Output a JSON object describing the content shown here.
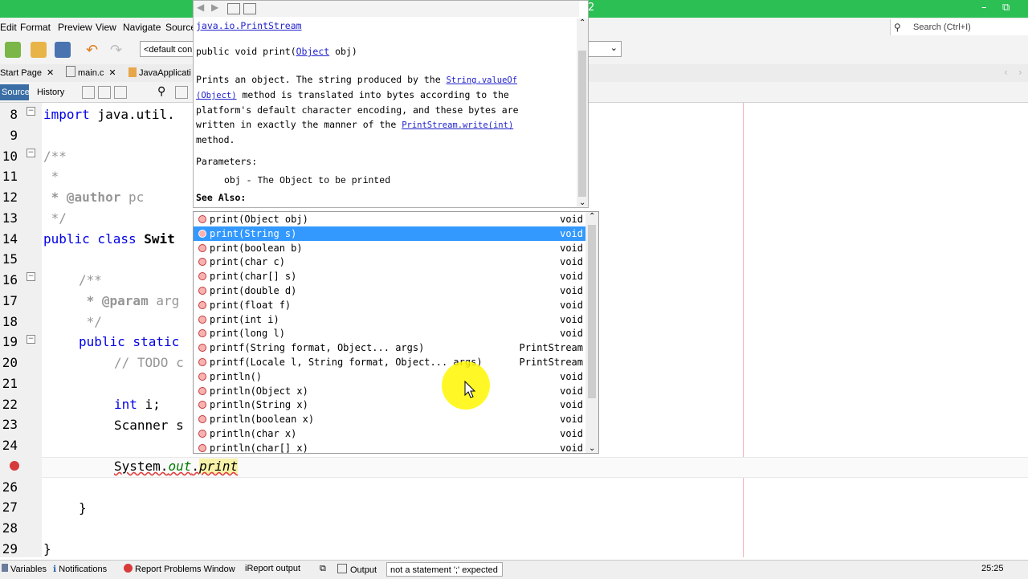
{
  "menu": {
    "items": [
      "Edit",
      "Format",
      "Preview",
      "View",
      "Navigate",
      "Source"
    ],
    "search_placeholder": "Search (Ctrl+I)"
  },
  "toolbar": {
    "config_value": "<default con"
  },
  "tabs": [
    {
      "label": "Start Page"
    },
    {
      "label": "main.c"
    },
    {
      "label": "JavaApplicati"
    }
  ],
  "editor_toolbar": {
    "source_label": "Source",
    "history_label": "History"
  },
  "editor": {
    "line_numbers": [
      "8",
      "9",
      "10",
      "11",
      "12",
      "13",
      "14",
      "15",
      "16",
      "17",
      "18",
      "19",
      "20",
      "21",
      "22",
      "23",
      "24",
      "",
      "26",
      "27",
      "28",
      "29"
    ],
    "lines": {
      "l8_kw": "import",
      "l8_rest": " java.util.",
      "l10": "/**",
      "l11": " *",
      "l12_tag": " * @author",
      "l12_rest": " pc",
      "l13": " */",
      "l14_kw": "public class",
      "l14_rest": " Swit",
      "l16": "/**",
      "l17_tag": " * @param",
      "l17_rest": " arg",
      "l18": " */",
      "l19_kw": "public static",
      "l20": "// TODO c",
      "l22_kw": "int",
      "l22_rest": " i;",
      "l23": "Scanner s",
      "l25_a": "System.",
      "l25_b": "out",
      "l25_c": ".",
      "l25_d": "print",
      "l27": "}",
      "l29": "}"
    }
  },
  "javadoc": {
    "class_link": "java.io.PrintStream",
    "signature_pre": "public void print(",
    "signature_link": "Object",
    "signature_post": " obj)",
    "desc_1": "Prints an object. The string produced by the ",
    "desc_link1": "String.valueOf",
    "desc_link1b": "(Object)",
    "desc_2": " method is translated into bytes according to the",
    "desc_3": "platform's default character encoding, and these bytes are",
    "desc_4": "written in exactly the manner of the ",
    "desc_link2": "PrintStream.write(int)",
    "desc_5": "method.",
    "params_header": "Parameters:",
    "param_name": "obj",
    "param_desc": " - The Object to be printed",
    "see_also": "See Also:"
  },
  "completion": {
    "items": [
      {
        "name": "print(Object obj)",
        "ret": "void"
      },
      {
        "name": "print(String s)",
        "ret": "void"
      },
      {
        "name": "print(boolean b)",
        "ret": "void"
      },
      {
        "name": "print(char c)",
        "ret": "void"
      },
      {
        "name": "print(char[] s)",
        "ret": "void"
      },
      {
        "name": "print(double d)",
        "ret": "void"
      },
      {
        "name": "print(float f)",
        "ret": "void"
      },
      {
        "name": "print(int i)",
        "ret": "void"
      },
      {
        "name": "print(long l)",
        "ret": "void"
      },
      {
        "name": "printf(String format, Object... args)",
        "ret": "PrintStream"
      },
      {
        "name": "printf(Locale l, String format, Object... args)",
        "ret": "PrintStream"
      },
      {
        "name": "println()",
        "ret": "void"
      },
      {
        "name": "println(Object x)",
        "ret": "void"
      },
      {
        "name": "println(String x)",
        "ret": "void"
      },
      {
        "name": "println(boolean x)",
        "ret": "void"
      },
      {
        "name": "println(char x)",
        "ret": "void"
      },
      {
        "name": "println(char[] x)",
        "ret": "void"
      }
    ],
    "selected_index": 1
  },
  "statusbar": {
    "variables": "Variables",
    "notifications": "Notifications",
    "report_problems": "Report Problems Window",
    "ireport": "iReport output",
    "output": "Output",
    "message": "not a statement  ';' expected",
    "position": "25:25"
  },
  "colors": {
    "titlebar": "#2bbf54",
    "selection": "#3399ff",
    "keyword": "#0000e6",
    "comment": "#969696",
    "cursor_highlight": "#fff700"
  }
}
